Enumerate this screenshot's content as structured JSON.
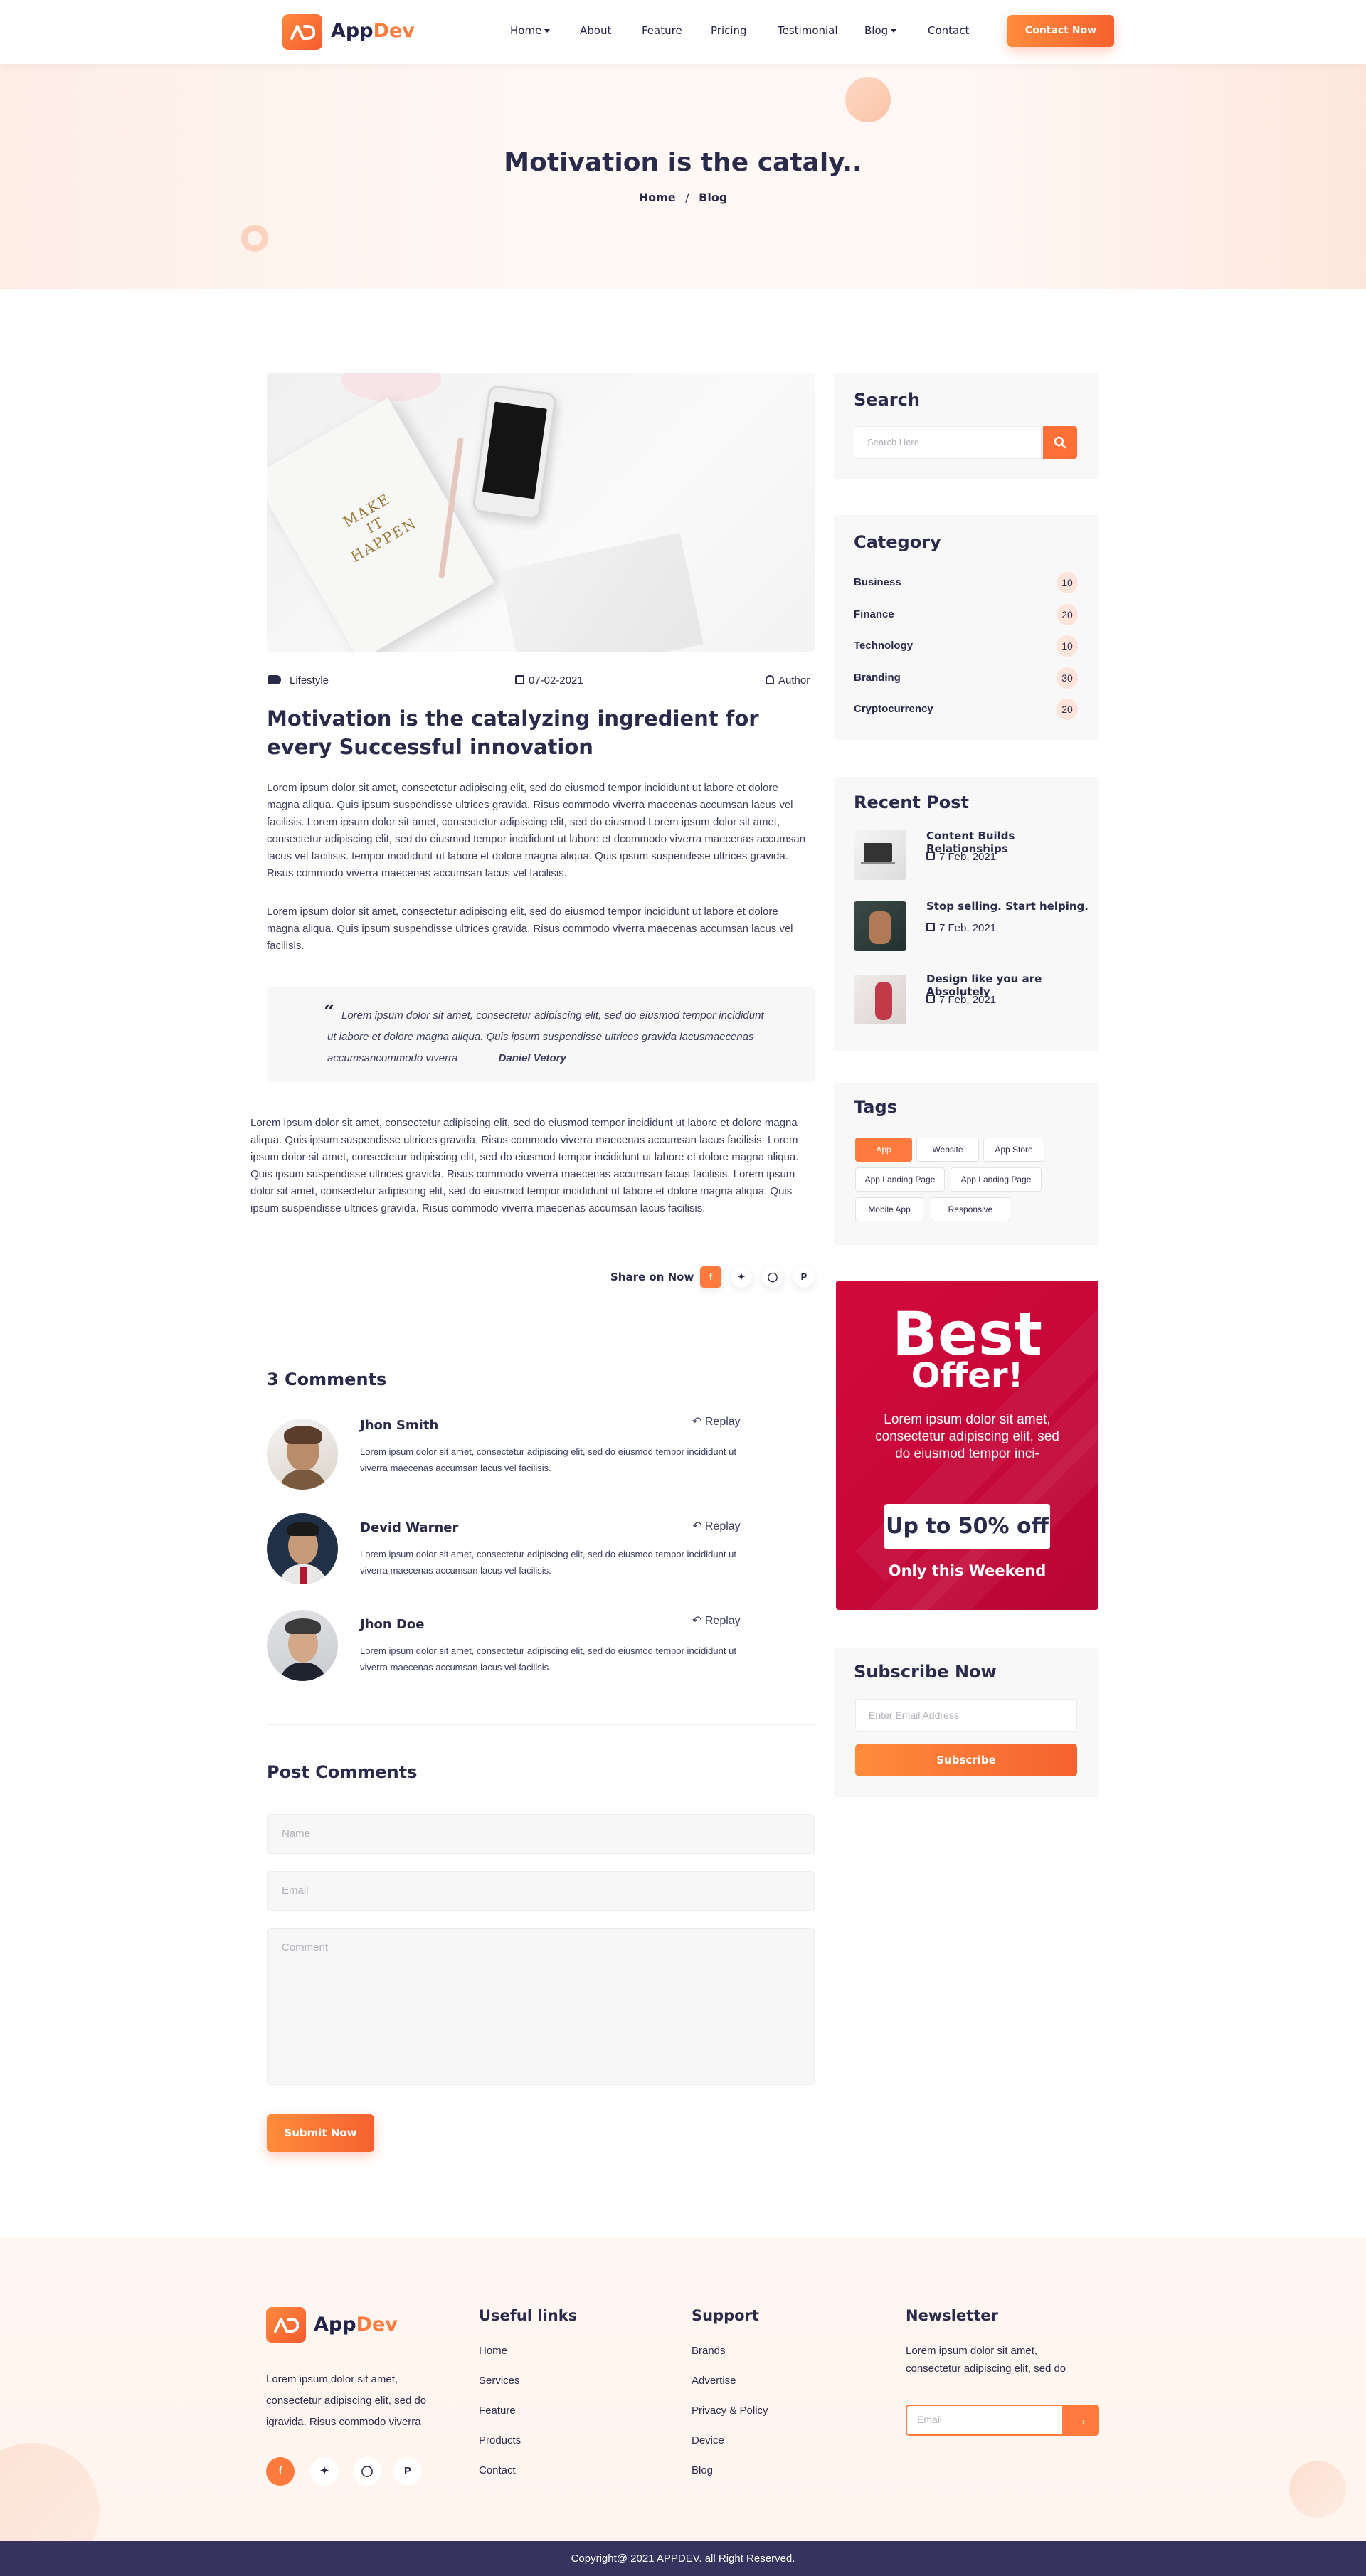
{
  "header": {
    "logo_part1": "App",
    "logo_part2": "Dev",
    "nav": [
      "Home",
      "About",
      "Feature",
      "Pricing",
      "Testimonial",
      "Blog",
      "Contact"
    ],
    "cta": "Contact Now"
  },
  "hero": {
    "title": "Motivation is the cataly..",
    "crumb_home": "Home",
    "crumb_sep": "/",
    "crumb_current": "Blog"
  },
  "post": {
    "image_text": [
      "MAKE",
      "IT",
      "HAPPEN"
    ],
    "category": "Lifestyle",
    "date": "07-02-2021",
    "author": "Author",
    "title": "Motivation is the catalyzing ingredient for every Successful innovation",
    "para1": "Lorem ipsum dolor sit amet, consectetur adipiscing elit, sed do eiusmod tempor incididunt ut labore et dolore magna aliqua. Quis ipsum suspendisse ultrices gravida. Risus commodo viverra maecenas accumsan lacus vel facilisis. Lorem ipsum dolor sit amet, consectetur adipiscing elit, sed do eiusmod Lorem ipsum dolor sit amet, consectetur adipiscing elit, sed do eiusmod tempor incididunt ut labore et dcommodo viverra maecenas accumsan lacus vel facilisis. tempor incididunt ut labore et dolore magna aliqua. Quis ipsum suspendisse ultrices gravida. Risus commodo viverra maecenas accumsan lacus vel facilisis.",
    "para2": "Lorem ipsum dolor sit amet, consectetur adipiscing elit, sed do eiusmod tempor incididunt ut labore et dolore magna aliqua. Quis ipsum suspendisse ultrices gravida. Risus commodo viverra maecenas accumsan lacus vel facilisis.",
    "quote": "Lorem ipsum dolor sit amet, consectetur adipiscing elit, sed do eiusmod tempor incididunt ut labore et dolore magna aliqua. Quis ipsum suspendisse ultrices gravida lacusmaecenas accumsancommodo viverra",
    "quote_author": "Daniel Vetory",
    "para3": "Lorem ipsum dolor sit amet, consectetur adipiscing elit, sed do eiusmod tempor incididunt ut labore et dolore magna aliqua. Quis ipsum suspendisse ultrices gravida. Risus commodo viverra maecenas accumsan lacus facilisis. Lorem ipsum dolor sit amet, consectetur adipiscing elit, sed do eiusmod tempor incididunt ut labore et dolore magna aliqua. Quis ipsum suspendisse ultrices gravida. Risus commodo viverra maecenas accumsan lacus facilisis. Lorem ipsum dolor sit amet, consectetur adipiscing elit, sed do eiusmod tempor incididunt ut labore et dolore magna aliqua. Quis ipsum suspendisse ultrices gravida. Risus commodo viverra maecenas accumsan lacus facilisis.",
    "share_label": "Share on Now",
    "share_icons": [
      "facebook-icon",
      "twitter-icon",
      "instagram-icon",
      "pinterest-icon"
    ]
  },
  "comments": {
    "heading": "3 Comments",
    "reply_label": "Replay",
    "items": [
      {
        "name": "Jhon Smith",
        "text": "Lorem ipsum dolor sit amet, consectetur adipiscing elit, sed do eiusmod tempor incididunt ut viverra maecenas accumsan lacus vel facilisis."
      },
      {
        "name": "Devid Warner",
        "text": "Lorem ipsum dolor sit amet, consectetur adipiscing elit, sed do eiusmod tempor incididunt ut viverra maecenas accumsan lacus vel facilisis."
      },
      {
        "name": "Jhon Doe",
        "text": "Lorem ipsum dolor sit amet, consectetur adipiscing elit, sed do eiusmod tempor incididunt ut viverra maecenas accumsan lacus vel facilisis."
      }
    ]
  },
  "post_comments": {
    "heading": "Post Comments",
    "name_placeholder": "Name",
    "email_placeholder": "Email",
    "comment_placeholder": "Comment",
    "submit": "Submit Now"
  },
  "sidebar": {
    "search_title": "Search",
    "search_placeholder": "Search  Here",
    "category_title": "Category",
    "categories": [
      {
        "label": "Business",
        "count": "10"
      },
      {
        "label": "Finance",
        "count": "20"
      },
      {
        "label": "Technology",
        "count": "10"
      },
      {
        "label": "Branding",
        "count": "30"
      },
      {
        "label": "Cryptocurrency",
        "count": "20"
      }
    ],
    "recent_title": "Recent Post",
    "recent": [
      {
        "title": "Content Builds Relationships",
        "date": "7 Feb, 2021"
      },
      {
        "title": "Stop selling. Start helping.",
        "date": "7 Feb, 2021"
      },
      {
        "title": "Design like you are Absolutely",
        "date": "7 Feb, 2021"
      }
    ],
    "tags_title": "Tags",
    "tags": [
      "App",
      "Website",
      "App Store",
      "App Landing Page",
      "App Landing Page",
      "Mobile App",
      "Responsive"
    ],
    "offer": {
      "best": "Best",
      "sub": "Offer!",
      "text": "Lorem ipsum dolor sit amet, consectetur adipiscing elit, sed do eiusmod tempor inci-",
      "pill": "Up to 50% off",
      "foot": "Only this Weekend"
    },
    "subscribe_title": "Subscribe Now",
    "subscribe_placeholder": "Enter Email Address",
    "subscribe_button": "Subscribe"
  },
  "footer": {
    "about": "Lorem ipsum dolor sit amet, consectetur adipiscing elit, sed do igravida. Risus commodo viverra",
    "useful_title": "Useful links",
    "useful": [
      "Home",
      "Services",
      "Feature",
      "Products",
      "Contact"
    ],
    "support_title": "Support",
    "support": [
      "Brands",
      "Advertise",
      "Privacy & Policy",
      "Device",
      "Blog"
    ],
    "newsletter_title": "Newsletter",
    "newsletter_text": "Lorem ipsum dolor sit amet, consectetur adipiscing elit, sed do",
    "newsletter_placeholder": "Email",
    "copyright": "Copyright@ 2021 APPDEV. all Right Reserved."
  },
  "colors": {
    "accent": "#ff7a3d",
    "dark": "#2a2b4a",
    "offer": "#d20a3c",
    "footer_bar": "#36335e"
  }
}
